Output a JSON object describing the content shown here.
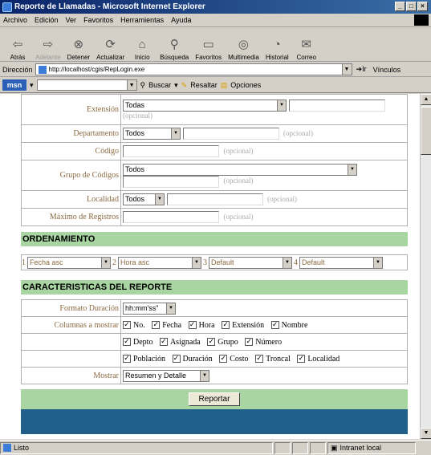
{
  "window": {
    "title": "Reporte de Llamadas - Microsoft Internet Explorer"
  },
  "menu": [
    "Archivo",
    "Edición",
    "Ver",
    "Favoritos",
    "Herramientas",
    "Ayuda"
  ],
  "toolbar": {
    "back": "Atrás",
    "forward": "Adelante",
    "stop": "Detener",
    "refresh": "Actualizar",
    "home": "Inicio",
    "search": "Búsqueda",
    "favorites": "Favoritos",
    "multimedia": "Multimedia",
    "history": "Historial",
    "mail": "Correo"
  },
  "address": {
    "label": "Dirección",
    "url": "http://localhost/cgis/RepLogin.exe",
    "go": "Ir",
    "links": "Vínculos"
  },
  "linksbar": {
    "msn": "msn",
    "search": "Buscar",
    "highlight": "Resaltar",
    "options": "Opciones"
  },
  "form": {
    "extension": {
      "label": "Extensión",
      "value": "Todas",
      "optional": "(opcional)"
    },
    "department": {
      "label": "Departamento",
      "value": "Todos",
      "optional": "(opcional)"
    },
    "code": {
      "label": "Código",
      "optional": "(opcional)"
    },
    "code_group": {
      "label": "Grupo de Códigos",
      "value": "Todos",
      "optional": "(opcional)"
    },
    "locality": {
      "label": "Localidad",
      "value": "Todos",
      "optional": "(opcional)"
    },
    "max_records": {
      "label": "Máximo de Registros",
      "optional": "(opcional)"
    }
  },
  "sorting": {
    "title": "ORDENAMIENTO",
    "items": [
      {
        "n": "1",
        "value": "Fecha asc"
      },
      {
        "n": "2",
        "value": "Hora asc"
      },
      {
        "n": "3",
        "value": "Default"
      },
      {
        "n": "4",
        "value": "Default"
      }
    ]
  },
  "report": {
    "title": "CARACTERISTICAS DEL REPORTE",
    "duration_label": "Formato Duración",
    "duration_value": "hh:mm'ss\"",
    "columns_label": "Columnas a mostrar",
    "columns_row1": [
      "No.",
      "Fecha",
      "Hora",
      "Extensión",
      "Nombre"
    ],
    "columns_row2": [
      "Depto",
      "Asignada",
      "Grupo",
      "Número"
    ],
    "columns_row3": [
      "Población",
      "Duración",
      "Costo",
      "Troncal",
      "Localidad"
    ],
    "show_label": "Mostrar",
    "show_value": "Resumen y Detalle",
    "submit": "Reportar"
  },
  "status": {
    "text": "Listo",
    "zone": "Intranet local"
  }
}
